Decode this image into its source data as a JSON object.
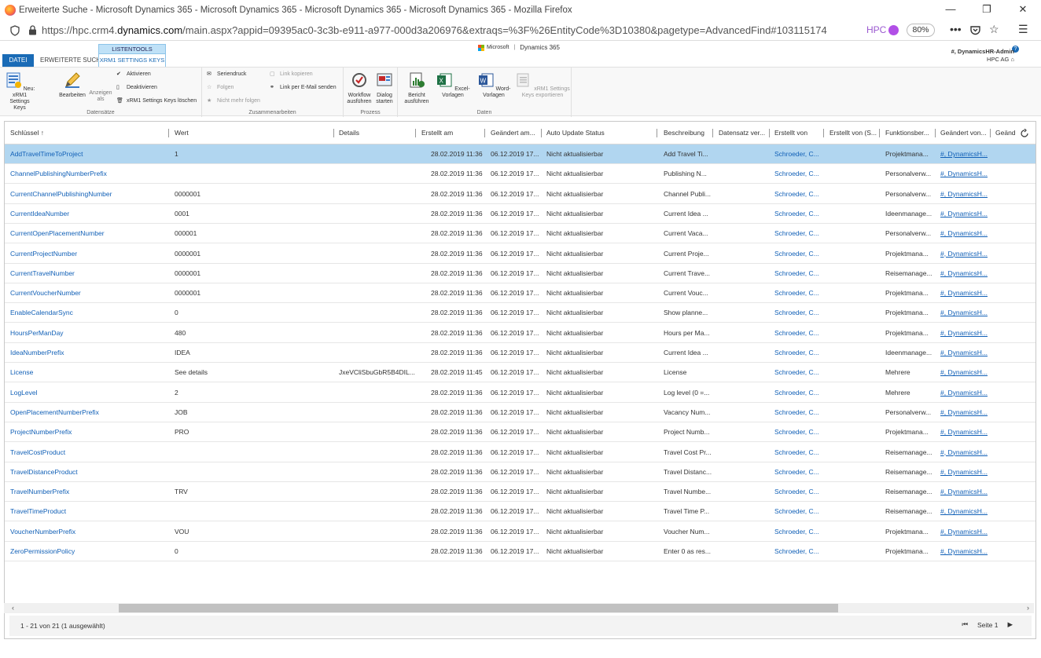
{
  "window": {
    "title": "Erweiterte Suche - Microsoft Dynamics 365 - Microsoft Dynamics 365 - Microsoft Dynamics 365 - Microsoft Dynamics 365 - Mozilla Firefox",
    "minimize": "—",
    "restore": "❐",
    "close": "✕"
  },
  "browser": {
    "url_prefix": "https://hpc.crm4.",
    "url_domain": "dynamics.com",
    "url_suffix": "/main.aspx?appid=09395ac0-3c3b-e911-a977-000d3a206976&extraqs=%3F%26EntityCode%3D10380&pagetype=AdvancedFind#103115174",
    "container_label": "HPC",
    "zoom": "80%"
  },
  "ribbon_tabs": {
    "datei": "DATEI",
    "erweiterte_suche": "ERWEITERTE SUCHE",
    "listentools": "LISTENTOOLS",
    "xrm1_keys": "XRM1 SETTINGS KEYS"
  },
  "brand": {
    "microsoft": "Microsoft",
    "product": "Dynamics 365"
  },
  "user": {
    "name": "#, DynamicsHR-Admin",
    "org": "HPC AG"
  },
  "ribbon": {
    "datensaetze": {
      "label": "Datensätze",
      "neu": "Neu: xRM1 Settings Keys",
      "bearbeiten": "Bearbeiten",
      "anzeigen": "Anzeigen als",
      "aktivieren": "Aktivieren",
      "deaktivieren": "Deaktivieren",
      "loeschen": "xRM1 Settings Keys löschen"
    },
    "zusammenarbeiten": {
      "label": "Zusammenarbeiten",
      "seriendruck": "Seriendruck",
      "folgen": "Folgen",
      "nicht_mehr_folgen": "Nicht mehr folgen",
      "link_kopieren": "Link kopieren",
      "link_email": "Link per E-Mail senden"
    },
    "prozess": {
      "label": "Prozess",
      "workflow": "Workflow ausführen",
      "dialog": "Dialog starten"
    },
    "daten": {
      "label": "Daten",
      "bericht": "Bericht ausführen",
      "excel": "Excel-Vorlagen",
      "word": "Word-Vorlagen",
      "export": "xRM1 Settings Keys exportieren"
    }
  },
  "grid": {
    "headers": {
      "schluessel": "Schlüssel",
      "sort_arrow": "↑",
      "wert": "Wert",
      "details": "Details",
      "erstellt_am": "Erstellt am",
      "geaendert_am": "Geändert am...",
      "auto_update": "Auto Update Status",
      "beschreibung": "Beschreibung",
      "datensatz_ver": "Datensatz ver...",
      "erstellt_von": "Erstellt von",
      "erstellt_von_s": "Erstellt von (S...",
      "funktionsber": "Funktionsber...",
      "geaendert_von": "Geändert von...",
      "geaendert_x": "Geänd"
    },
    "rows": [
      {
        "key": "AddTravelTimeToProject",
        "wert": "1",
        "details": "",
        "erstellt": "28.02.2019 11:36",
        "geaendert": "06.12.2019 17...",
        "status": "Nicht aktualisierbar",
        "beschreibung": "Add Travel Ti...",
        "erstellt_von": "Schroeder, C...",
        "funktion": "Projektmana...",
        "geaendert_von": "#, DynamicsH..."
      },
      {
        "key": "ChannelPublishingNumberPrefix",
        "wert": "",
        "details": "",
        "erstellt": "28.02.2019 11:36",
        "geaendert": "06.12.2019 17...",
        "status": "Nicht aktualisierbar",
        "beschreibung": "Publishing N...",
        "erstellt_von": "Schroeder, C...",
        "funktion": "Personalverw...",
        "geaendert_von": "#, DynamicsH..."
      },
      {
        "key": "CurrentChannelPublishingNumber",
        "wert": "0000001",
        "details": "",
        "erstellt": "28.02.2019 11:36",
        "geaendert": "06.12.2019 17...",
        "status": "Nicht aktualisierbar",
        "beschreibung": "Channel Publi...",
        "erstellt_von": "Schroeder, C...",
        "funktion": "Personalverw...",
        "geaendert_von": "#, DynamicsH..."
      },
      {
        "key": "CurrentIdeaNumber",
        "wert": "0001",
        "details": "",
        "erstellt": "28.02.2019 11:36",
        "geaendert": "06.12.2019 17...",
        "status": "Nicht aktualisierbar",
        "beschreibung": "Current Idea ...",
        "erstellt_von": "Schroeder, C...",
        "funktion": "Ideenmanage...",
        "geaendert_von": "#, DynamicsH..."
      },
      {
        "key": "CurrentOpenPlacementNumber",
        "wert": "000001",
        "details": "",
        "erstellt": "28.02.2019 11:36",
        "geaendert": "06.12.2019 17...",
        "status": "Nicht aktualisierbar",
        "beschreibung": "Current Vaca...",
        "erstellt_von": "Schroeder, C...",
        "funktion": "Personalverw...",
        "geaendert_von": "#, DynamicsH..."
      },
      {
        "key": "CurrentProjectNumber",
        "wert": "0000001",
        "details": "",
        "erstellt": "28.02.2019 11:36",
        "geaendert": "06.12.2019 17...",
        "status": "Nicht aktualisierbar",
        "beschreibung": "Current Proje...",
        "erstellt_von": "Schroeder, C...",
        "funktion": "Projektmana...",
        "geaendert_von": "#, DynamicsH..."
      },
      {
        "key": "CurrentTravelNumber",
        "wert": "0000001",
        "details": "",
        "erstellt": "28.02.2019 11:36",
        "geaendert": "06.12.2019 17...",
        "status": "Nicht aktualisierbar",
        "beschreibung": "Current Trave...",
        "erstellt_von": "Schroeder, C...",
        "funktion": "Reisemanage...",
        "geaendert_von": "#, DynamicsH..."
      },
      {
        "key": "CurrentVoucherNumber",
        "wert": "0000001",
        "details": "",
        "erstellt": "28.02.2019 11:36",
        "geaendert": "06.12.2019 17...",
        "status": "Nicht aktualisierbar",
        "beschreibung": "Current Vouc...",
        "erstellt_von": "Schroeder, C...",
        "funktion": "Projektmana...",
        "geaendert_von": "#, DynamicsH..."
      },
      {
        "key": "EnableCalendarSync",
        "wert": "0",
        "details": "",
        "erstellt": "28.02.2019 11:36",
        "geaendert": "06.12.2019 17...",
        "status": "Nicht aktualisierbar",
        "beschreibung": "Show planne...",
        "erstellt_von": "Schroeder, C...",
        "funktion": "Projektmana...",
        "geaendert_von": "#, DynamicsH..."
      },
      {
        "key": "HoursPerManDay",
        "wert": "480",
        "details": "",
        "erstellt": "28.02.2019 11:36",
        "geaendert": "06.12.2019 17...",
        "status": "Nicht aktualisierbar",
        "beschreibung": "Hours per Ma...",
        "erstellt_von": "Schroeder, C...",
        "funktion": "Projektmana...",
        "geaendert_von": "#, DynamicsH..."
      },
      {
        "key": "IdeaNumberPrefix",
        "wert": "IDEA",
        "details": "",
        "erstellt": "28.02.2019 11:36",
        "geaendert": "06.12.2019 17...",
        "status": "Nicht aktualisierbar",
        "beschreibung": "Current Idea ...",
        "erstellt_von": "Schroeder, C...",
        "funktion": "Ideenmanage...",
        "geaendert_von": "#, DynamicsH..."
      },
      {
        "key": "License",
        "wert": "See details",
        "details": "JxeVCliSbuGbR5B4DIL...",
        "erstellt": "28.02.2019 11:45",
        "geaendert": "06.12.2019 17...",
        "status": "Nicht aktualisierbar",
        "beschreibung": "License",
        "erstellt_von": "Schroeder, C...",
        "funktion": "Mehrere",
        "geaendert_von": "#, DynamicsH..."
      },
      {
        "key": "LogLevel",
        "wert": "2",
        "details": "",
        "erstellt": "28.02.2019 11:36",
        "geaendert": "06.12.2019 17...",
        "status": "Nicht aktualisierbar",
        "beschreibung": "Log level (0 =...",
        "erstellt_von": "Schroeder, C...",
        "funktion": "Mehrere",
        "geaendert_von": "#, DynamicsH..."
      },
      {
        "key": "OpenPlacementNumberPrefix",
        "wert": "JOB",
        "details": "",
        "erstellt": "28.02.2019 11:36",
        "geaendert": "06.12.2019 17...",
        "status": "Nicht aktualisierbar",
        "beschreibung": "Vacancy Num...",
        "erstellt_von": "Schroeder, C...",
        "funktion": "Personalverw...",
        "geaendert_von": "#, DynamicsH..."
      },
      {
        "key": "ProjectNumberPrefix",
        "wert": "PRO",
        "details": "",
        "erstellt": "28.02.2019 11:36",
        "geaendert": "06.12.2019 17...",
        "status": "Nicht aktualisierbar",
        "beschreibung": "Project Numb...",
        "erstellt_von": "Schroeder, C...",
        "funktion": "Projektmana...",
        "geaendert_von": "#, DynamicsH..."
      },
      {
        "key": "TravelCostProduct",
        "wert": "",
        "details": "",
        "erstellt": "28.02.2019 11:36",
        "geaendert": "06.12.2019 17...",
        "status": "Nicht aktualisierbar",
        "beschreibung": "Travel Cost Pr...",
        "erstellt_von": "Schroeder, C...",
        "funktion": "Reisemanage...",
        "geaendert_von": "#, DynamicsH..."
      },
      {
        "key": "TravelDistanceProduct",
        "wert": "",
        "details": "",
        "erstellt": "28.02.2019 11:36",
        "geaendert": "06.12.2019 17...",
        "status": "Nicht aktualisierbar",
        "beschreibung": "Travel Distanc...",
        "erstellt_von": "Schroeder, C...",
        "funktion": "Reisemanage...",
        "geaendert_von": "#, DynamicsH..."
      },
      {
        "key": "TravelNumberPrefix",
        "wert": "TRV",
        "details": "",
        "erstellt": "28.02.2019 11:36",
        "geaendert": "06.12.2019 17...",
        "status": "Nicht aktualisierbar",
        "beschreibung": "Travel Numbe...",
        "erstellt_von": "Schroeder, C...",
        "funktion": "Reisemanage...",
        "geaendert_von": "#, DynamicsH..."
      },
      {
        "key": "TravelTimeProduct",
        "wert": "",
        "details": "",
        "erstellt": "28.02.2019 11:36",
        "geaendert": "06.12.2019 17...",
        "status": "Nicht aktualisierbar",
        "beschreibung": "Travel Time P...",
        "erstellt_von": "Schroeder, C...",
        "funktion": "Reisemanage...",
        "geaendert_von": "#, DynamicsH..."
      },
      {
        "key": "VoucherNumberPrefix",
        "wert": "VOU",
        "details": "",
        "erstellt": "28.02.2019 11:36",
        "geaendert": "06.12.2019 17...",
        "status": "Nicht aktualisierbar",
        "beschreibung": "Voucher Num...",
        "erstellt_von": "Schroeder, C...",
        "funktion": "Projektmana...",
        "geaendert_von": "#, DynamicsH..."
      },
      {
        "key": "ZeroPermissionPolicy",
        "wert": "0",
        "details": "",
        "erstellt": "28.02.2019 11:36",
        "geaendert": "06.12.2019 17...",
        "status": "Nicht aktualisierbar",
        "beschreibung": "Enter 0 as res...",
        "erstellt_von": "Schroeder, C...",
        "funktion": "Projektmana...",
        "geaendert_von": "#, DynamicsH..."
      }
    ],
    "selected_row": 0
  },
  "footer": {
    "count": "1 - 21  von 21 (1 ausgewählt)",
    "page": "Seite 1"
  }
}
